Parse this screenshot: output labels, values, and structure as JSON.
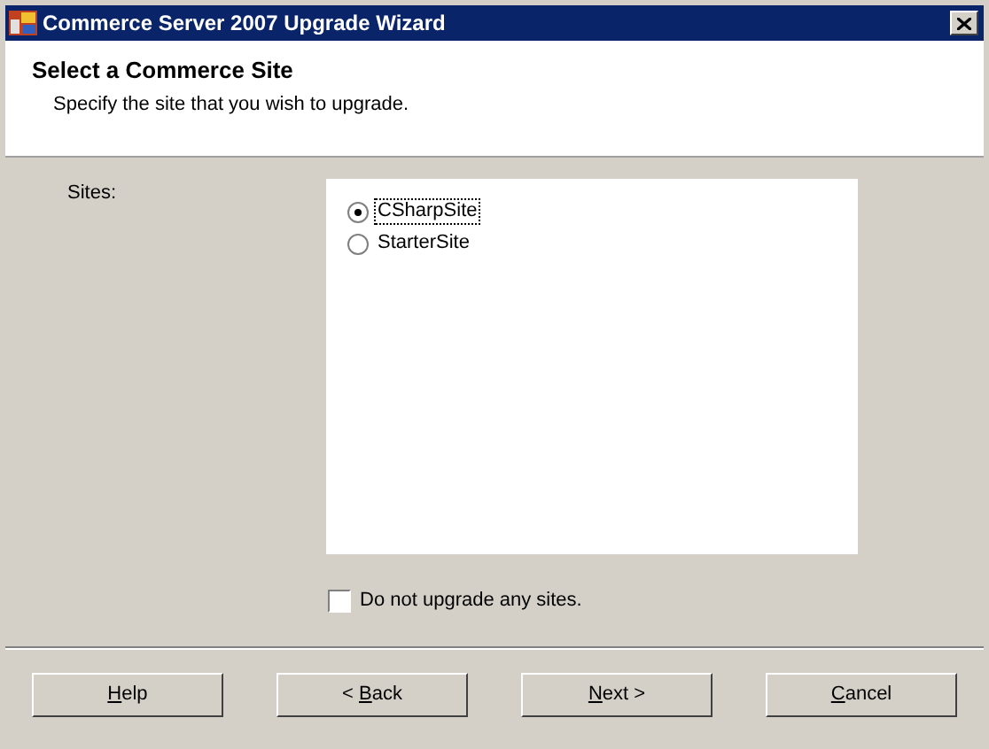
{
  "window": {
    "title": "Commerce Server 2007 Upgrade Wizard"
  },
  "header": {
    "title": "Select a Commerce Site",
    "subtitle": "Specify the site that you wish to upgrade."
  },
  "sites": {
    "label": "Sites:",
    "items": [
      {
        "label": "CSharpSite",
        "selected": true,
        "focused": true
      },
      {
        "label": "StarterSite",
        "selected": false,
        "focused": false
      }
    ]
  },
  "skip_option": {
    "label": "Do not upgrade any sites.",
    "checked": false
  },
  "buttons": [
    {
      "key": "H",
      "post": "elp"
    },
    {
      "pre": "< ",
      "key": "B",
      "post": "ack"
    },
    {
      "key": "N",
      "post": "ext >"
    },
    {
      "key": "C",
      "post": "ancel"
    }
  ]
}
